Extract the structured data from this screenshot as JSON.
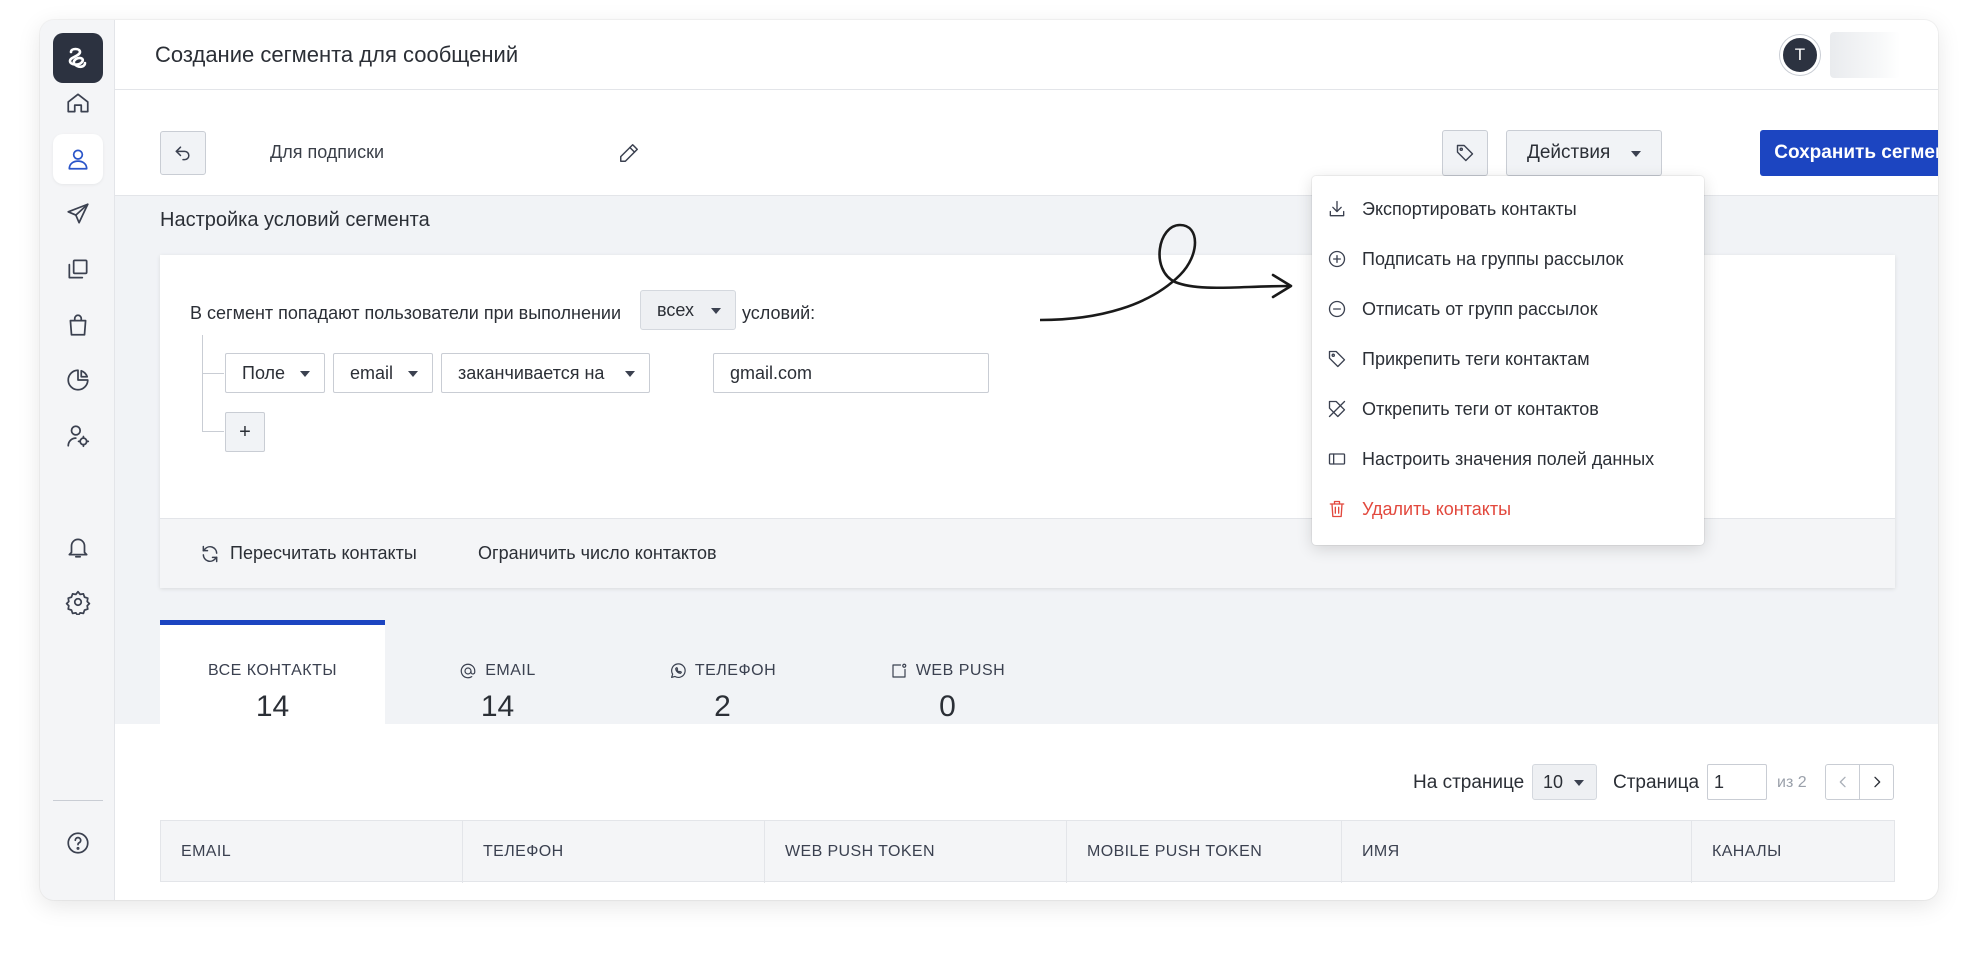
{
  "page": {
    "title": "Создание сегмента для сообщений",
    "avatar_initial": "T"
  },
  "segment": {
    "name": "Для подписки",
    "actions_label": "Действия",
    "save_label": "Сохранить сегмент"
  },
  "conditions": {
    "title": "Настройка условий сегмента",
    "rule_prefix": "В сегмент попадают пользователи при выполнении",
    "rule_match": "всех",
    "rule_suffix": "условий:",
    "row": {
      "field_type": "Поле",
      "field": "email",
      "operator": "заканчивается на",
      "value": "gmail.com"
    },
    "add_label": "+",
    "recalc_label": "Пересчитать контакты",
    "limit_label": "Ограничить число контактов"
  },
  "actions_menu": [
    {
      "label": "Экспортировать контакты",
      "icon": "download-icon"
    },
    {
      "label": "Подписать на группы рассылок",
      "icon": "plus-circle-icon"
    },
    {
      "label": "Отписать от групп рассылок",
      "icon": "minus-circle-icon"
    },
    {
      "label": "Прикрепить теги контактам",
      "icon": "tag-icon"
    },
    {
      "label": "Открепить теги от контактов",
      "icon": "tag-off-icon"
    },
    {
      "label": "Настроить значения полей данных",
      "icon": "field-icon"
    },
    {
      "label": "Удалить контакты",
      "icon": "trash-icon",
      "color": "#e2483d"
    }
  ],
  "tabs": [
    {
      "label": "ВСЕ КОНТАКТЫ",
      "count": "14"
    },
    {
      "label": "EMAIL",
      "count": "14",
      "icon": "at-icon"
    },
    {
      "label": "ТЕЛЕФОН",
      "count": "2",
      "icon": "whatsapp-icon"
    },
    {
      "label": "WEB PUSH",
      "count": "0",
      "icon": "webpush-icon"
    }
  ],
  "pagination": {
    "per_page_label": "На странице",
    "per_page": "10",
    "page_label": "Страница",
    "page": "1",
    "of_label": "из 2"
  },
  "table": {
    "columns": [
      "EMAIL",
      "ТЕЛЕФОН",
      "WEB PUSH TOKEN",
      "MOBILE PUSH TOKEN",
      "ИМЯ",
      "КАНАЛЫ"
    ]
  },
  "colors": {
    "accent": "#1c45c1",
    "danger": "#e2483d",
    "sidebar_dark": "#2c3240"
  }
}
